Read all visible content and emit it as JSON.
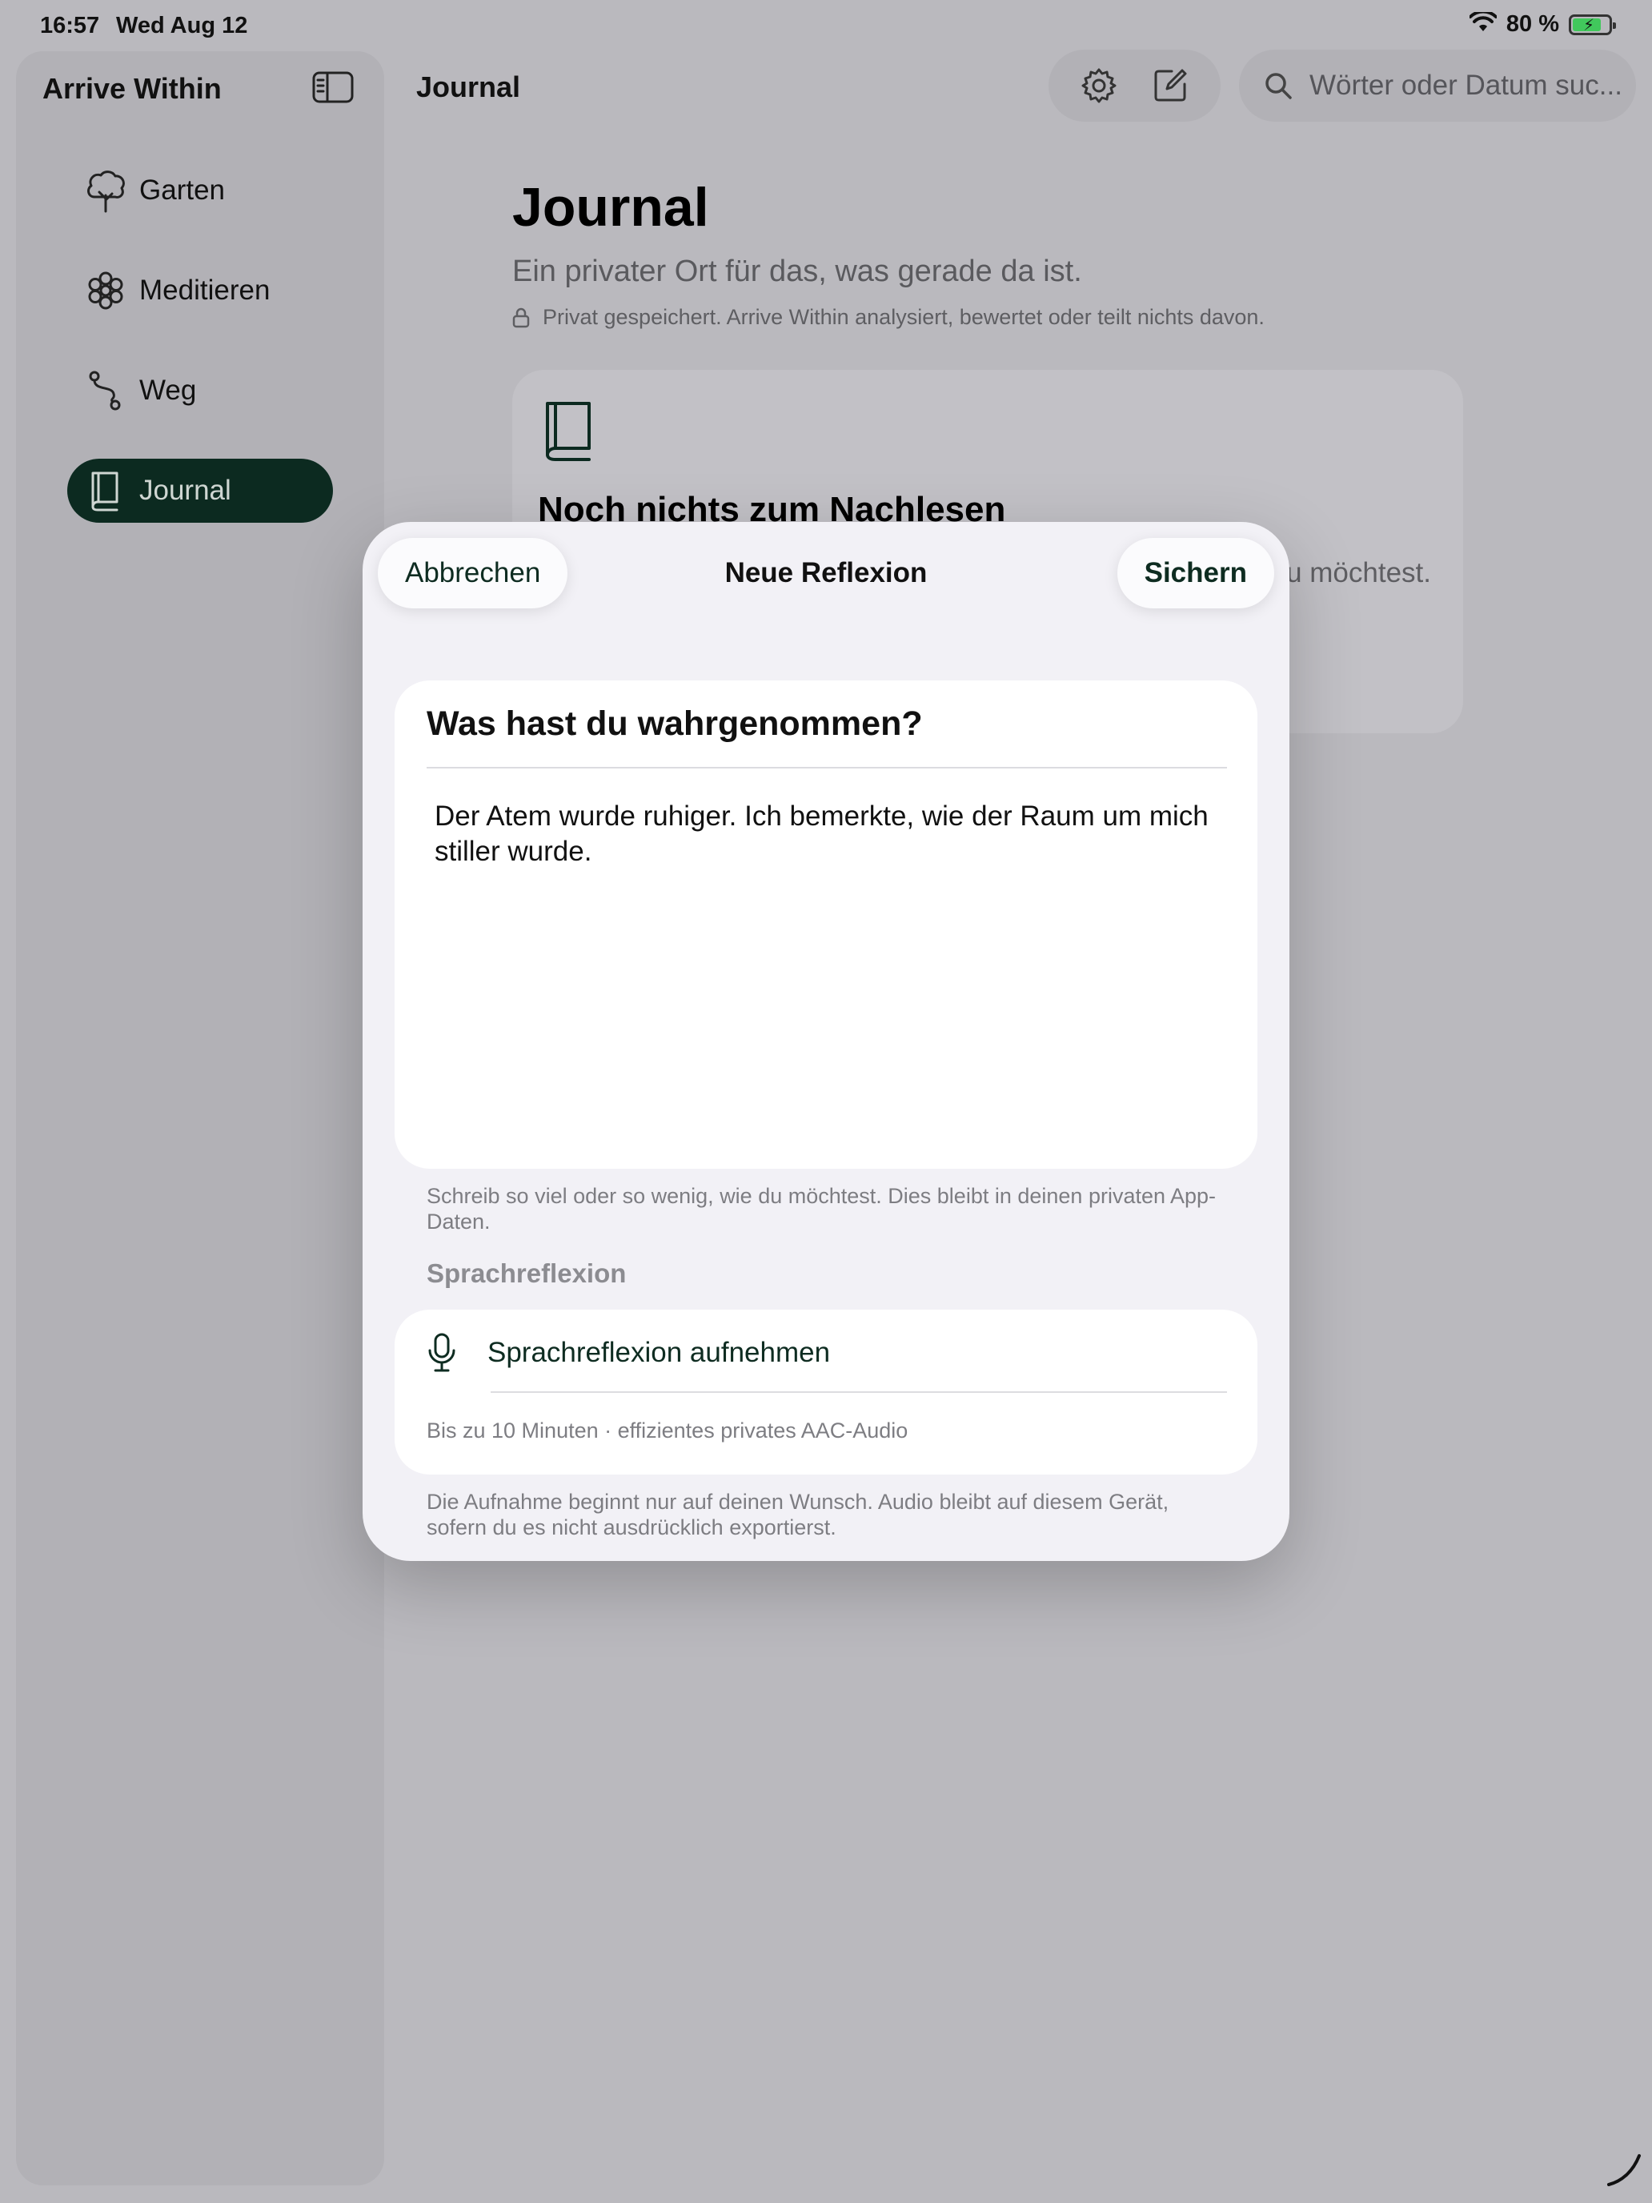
{
  "status_bar": {
    "time": "16:57",
    "date": "Wed Aug 12",
    "battery": "80 %",
    "battery_level": 0.8
  },
  "sidebar": {
    "app_title": "Arrive Within",
    "items": [
      {
        "label": "Garten",
        "icon": "tree-icon"
      },
      {
        "label": "Meditieren",
        "icon": "flower-icon"
      },
      {
        "label": "Weg",
        "icon": "path-icon"
      },
      {
        "label": "Journal",
        "icon": "book-icon",
        "active": true
      }
    ]
  },
  "header": {
    "title": "Journal",
    "search_placeholder": "Wörter oder Datum suc..."
  },
  "page": {
    "heading": "Journal",
    "subtitle": "Ein privater Ort für das, was gerade da ist.",
    "privacy": "Privat gespeichert. Arrive Within analysiert, bewertet oder teilt nichts davon.",
    "empty_title": "Noch nichts zum Nachlesen",
    "empty_sub_partial": "u möchtest."
  },
  "modal": {
    "title": "Neue Reflexion",
    "cancel_label": "Abbrechen",
    "save_label": "Sichern",
    "question": "Was hast du wahrgenommen?",
    "entry_text": "Der Atem wurde ruhiger. Ich bemerkte, wie der Raum um mich stiller wurde.",
    "hint": "Schreib so viel oder so wenig, wie du möchtest. Dies bleibt in deinen privaten App-Daten.",
    "voice_section_label": "Sprachreflexion",
    "voice_button_label": "Sprachreflexion aufnehmen",
    "voice_meta": "Bis zu 10 Minuten · effizientes privates AAC-Audio",
    "voice_footer": "Die Aufnahme beginnt nur auf deinen Wunsch. Audio bleibt auf diesem Gerät, sofern du es nicht ausdrücklich exportierst."
  },
  "colors": {
    "accent": "#0c2a20",
    "background": "#bab9be",
    "modal_bg": "#f2f1f6"
  }
}
